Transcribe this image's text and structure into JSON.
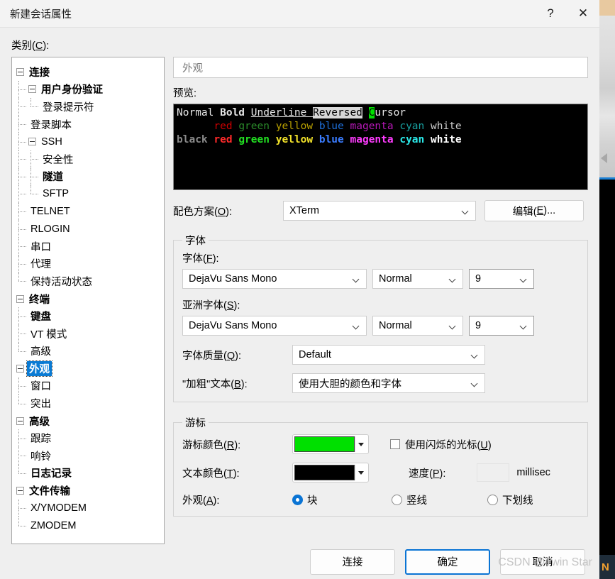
{
  "window": {
    "title": "新建会话属性",
    "help_label": "?",
    "close_label": "✕"
  },
  "category": {
    "label_prefix": "类别(",
    "label_key": "C",
    "label_suffix": "):"
  },
  "tree": {
    "items": [
      {
        "label": "连接",
        "depth": 0,
        "bold": true,
        "toggle": true,
        "selected": false
      },
      {
        "label": "用户身份验证",
        "depth": 1,
        "bold": true,
        "toggle": true,
        "selected": false
      },
      {
        "label": "登录提示符",
        "depth": 2,
        "bold": false,
        "toggle": false,
        "selected": false,
        "last": true
      },
      {
        "label": "登录脚本",
        "depth": 1,
        "bold": false,
        "toggle": false,
        "selected": false
      },
      {
        "label": "SSH",
        "depth": 1,
        "bold": false,
        "toggle": true,
        "selected": false
      },
      {
        "label": "安全性",
        "depth": 2,
        "bold": false,
        "toggle": false,
        "selected": false
      },
      {
        "label": "隧道",
        "depth": 2,
        "bold": true,
        "toggle": false,
        "selected": false
      },
      {
        "label": "SFTP",
        "depth": 2,
        "bold": false,
        "toggle": false,
        "selected": false,
        "last": true
      },
      {
        "label": "TELNET",
        "depth": 1,
        "bold": false,
        "toggle": false,
        "selected": false
      },
      {
        "label": "RLOGIN",
        "depth": 1,
        "bold": false,
        "toggle": false,
        "selected": false
      },
      {
        "label": "串口",
        "depth": 1,
        "bold": false,
        "toggle": false,
        "selected": false
      },
      {
        "label": "代理",
        "depth": 1,
        "bold": false,
        "toggle": false,
        "selected": false
      },
      {
        "label": "保持活动状态",
        "depth": 1,
        "bold": false,
        "toggle": false,
        "selected": false,
        "last": true
      },
      {
        "label": "终端",
        "depth": 0,
        "bold": true,
        "toggle": true,
        "selected": false
      },
      {
        "label": "键盘",
        "depth": 1,
        "bold": true,
        "toggle": false,
        "selected": false
      },
      {
        "label": "VT 模式",
        "depth": 1,
        "bold": false,
        "toggle": false,
        "selected": false
      },
      {
        "label": "高级",
        "depth": 1,
        "bold": false,
        "toggle": false,
        "selected": false,
        "last": true
      },
      {
        "label": "外观",
        "depth": 0,
        "bold": true,
        "toggle": true,
        "selected": true
      },
      {
        "label": "窗口",
        "depth": 1,
        "bold": false,
        "toggle": false,
        "selected": false
      },
      {
        "label": "突出",
        "depth": 1,
        "bold": false,
        "toggle": false,
        "selected": false,
        "last": true
      },
      {
        "label": "高级",
        "depth": 0,
        "bold": true,
        "toggle": true,
        "selected": false
      },
      {
        "label": "跟踪",
        "depth": 1,
        "bold": false,
        "toggle": false,
        "selected": false
      },
      {
        "label": "响铃",
        "depth": 1,
        "bold": false,
        "toggle": false,
        "selected": false
      },
      {
        "label": "日志记录",
        "depth": 1,
        "bold": true,
        "toggle": false,
        "selected": false,
        "last": true
      },
      {
        "label": "文件传输",
        "depth": 0,
        "bold": true,
        "toggle": true,
        "selected": false
      },
      {
        "label": "X/YMODEM",
        "depth": 1,
        "bold": false,
        "toggle": false,
        "selected": false
      },
      {
        "label": "ZMODEM",
        "depth": 1,
        "bold": false,
        "toggle": false,
        "selected": false,
        "last": true
      }
    ]
  },
  "pane": {
    "header": "外观",
    "preview_label": "预览:"
  },
  "preview": {
    "line1": {
      "normal": "Normal ",
      "bold": "Bold ",
      "underline": "Underline ",
      "reversed": "Reversed",
      "space": " ",
      "cursor_char": "C",
      "cursor_rest": "ursor"
    },
    "line2_indent": "      ",
    "line2": [
      "red",
      "green",
      "yellow",
      "blue",
      "magenta",
      "cyan",
      "white"
    ],
    "line3": [
      "black",
      "red",
      "green",
      "yellow",
      "blue",
      "magenta",
      "cyan",
      "white"
    ]
  },
  "scheme": {
    "label_prefix": "配色方案(",
    "label_key": "O",
    "label_suffix": "):",
    "value": "XTerm",
    "edit_prefix": "编辑(",
    "edit_key": "E",
    "edit_suffix": ")..."
  },
  "font_group": {
    "legend": "字体",
    "font_label_prefix": "字体(",
    "font_label_key": "F",
    "font_label_suffix": "):",
    "font_family": "DejaVu Sans Mono",
    "font_style": "Normal",
    "font_size": "9",
    "asian_label_prefix": "亚洲字体(",
    "asian_label_key": "S",
    "asian_label_suffix": "):",
    "asian_family": "DejaVu Sans Mono",
    "asian_style": "Normal",
    "asian_size": "9",
    "quality_label_prefix": "字体质量(",
    "quality_label_key": "Q",
    "quality_label_suffix": "):",
    "quality_value": "Default",
    "bold_label_prefix": "\"加粗\"文本(",
    "bold_label_key": "B",
    "bold_label_suffix": "):",
    "bold_value": "使用大胆的颜色和字体"
  },
  "cursor_group": {
    "legend": "游标",
    "cursor_color_prefix": "游标颜色(",
    "cursor_color_key": "R",
    "cursor_color_suffix": "):",
    "cursor_color_value": "#00e000",
    "text_color_prefix": "文本颜色(",
    "text_color_key": "T",
    "text_color_suffix": "):",
    "text_color_value": "#000000",
    "blink_prefix": "使用闪烁的光标(",
    "blink_key": "U",
    "blink_suffix": ")",
    "blink_checked": false,
    "speed_prefix": "速度(",
    "speed_key": "P",
    "speed_suffix": "):",
    "speed_value": "",
    "speed_unit": "millisec",
    "appearance_prefix": "外观(",
    "appearance_key": "A",
    "appearance_suffix": "):",
    "options": [
      {
        "label": "块",
        "selected": true
      },
      {
        "label": "竖线",
        "selected": false
      },
      {
        "label": "下划线",
        "selected": false
      }
    ]
  },
  "footer": {
    "connect": "连接",
    "ok": "确定",
    "cancel": "取消"
  },
  "watermark": "CSDN @Twin Star",
  "background_window": {
    "taskbar_text": "N"
  }
}
